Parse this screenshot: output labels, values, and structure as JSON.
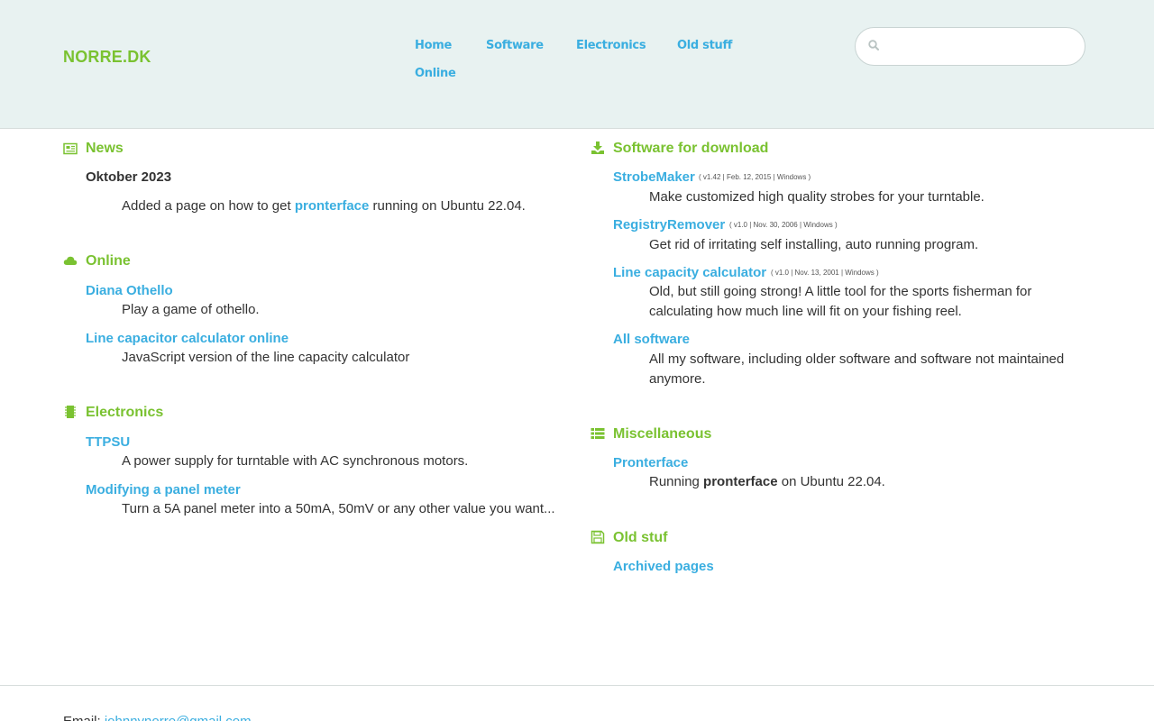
{
  "brand": "NORRE.DK",
  "nav": [
    "Home",
    "Software",
    "Electronics",
    "Old stuff",
    "Online"
  ],
  "search": {
    "placeholder": ""
  },
  "colors": {
    "accent_green": "#7ac231",
    "link_blue": "#3aaee0",
    "header_bg": "#e8f2f1"
  },
  "news": {
    "title": "News",
    "icon": "newspaper-icon",
    "month": "Oktober 2023",
    "entry_prefix": "Added a page on how to get ",
    "entry_link": "pronterface",
    "entry_suffix": " running on Ubuntu 22.04."
  },
  "online": {
    "title": "Online",
    "icon": "cloud-icon",
    "items": [
      {
        "label": "Diana Othello",
        "desc": "Play a game of othello."
      },
      {
        "label": "Line capacitor calculator online",
        "desc": "JavaScript version of the line capacity calculator"
      }
    ]
  },
  "electronics": {
    "title": "Electronics",
    "icon": "chip-icon",
    "items": [
      {
        "label": "TTPSU",
        "desc": "A power supply for turntable with AC synchronous motors."
      },
      {
        "label": "Modifying a panel meter",
        "desc": "Turn a 5A panel meter into a 50mA, 50mV or any other value you want..."
      }
    ]
  },
  "software": {
    "title": "Software for download",
    "icon": "download-icon",
    "items": [
      {
        "label": "StrobeMaker",
        "meta": "( v1.42 | Feb. 12, 2015 | Windows )",
        "desc": "Make customized high quality strobes for your turntable."
      },
      {
        "label": "RegistryRemover",
        "meta": "( v1.0 | Nov. 30, 2006 | Windows )",
        "desc": "Get rid of irritating self installing, auto running program."
      },
      {
        "label": "Line capacity calculator",
        "meta": "( v1.0 | Nov. 13, 2001 | Windows )",
        "desc": "Old, but still going strong! A little tool for the sports fisherman for calculating how much line will fit on your fishing reel."
      },
      {
        "label": "All software",
        "meta": "",
        "desc": "All my software, including older software and software not maintained anymore."
      }
    ]
  },
  "misc": {
    "title": "Miscellaneous",
    "icon": "list-icon",
    "item_label": "Pronterface",
    "desc_prefix": "Running ",
    "desc_bold": "pronterface",
    "desc_suffix": " on Ubuntu 22.04."
  },
  "oldstuff": {
    "title": "Old stuf",
    "icon": "floppy-disk-icon",
    "item_label": "Archived pages"
  },
  "footer": {
    "email_label": "Email: ",
    "email": "johnnynorre@gmail.com"
  }
}
